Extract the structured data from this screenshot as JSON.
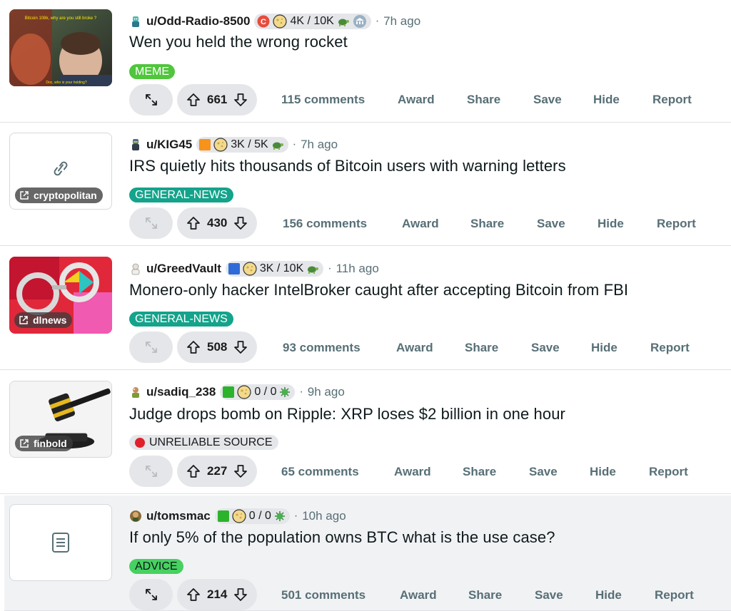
{
  "colors": {
    "meme": "#4fc63b",
    "general_news": "#14a38b",
    "advice": "#46d160",
    "unreliable_dot": "#e0202a"
  },
  "posts": [
    {
      "username": "u/Odd-Radio-8500",
      "flair_text": "4K / 10K",
      "time": "7h ago",
      "title": "Wen you held the wrong rocket",
      "tag": "MEME",
      "votes": "661",
      "comments": "115 comments",
      "thumb_caption": "Bitcoin 108k, why are you still broke ?",
      "thumb_caption2": "Doc, who is your holding?"
    },
    {
      "username": "u/KIG45",
      "flair_text": "3K / 5K",
      "time": "7h ago",
      "title": "IRS quietly hits thousands of Bitcoin users with warning letters",
      "tag": "GENERAL-NEWS",
      "votes": "430",
      "comments": "156 comments",
      "domain": "cryptopolitan"
    },
    {
      "username": "u/GreedVault",
      "flair_text": "3K / 10K",
      "time": "11h ago",
      "title": "Monero-only hacker IntelBroker caught after accepting Bitcoin from FBI",
      "tag": "GENERAL-NEWS",
      "votes": "508",
      "comments": "93 comments",
      "domain": "dlnews"
    },
    {
      "username": "u/sadiq_238",
      "flair_text": "0 / 0",
      "time": "9h ago",
      "title": "Judge drops bomb on Ripple: XRP loses $2 billion in one hour",
      "tag": "UNRELIABLE SOURCE",
      "votes": "227",
      "comments": "65 comments",
      "domain": "finbold"
    },
    {
      "username": "u/tomsmac",
      "flair_text": "0 / 0",
      "time": "10h ago",
      "title": "If only 5% of the population owns BTC what is the use case?",
      "tag": "ADVICE",
      "votes": "214",
      "comments": "501 comments"
    }
  ],
  "labels": {
    "sep": "·",
    "award": "Award",
    "share": "Share",
    "save": "Save",
    "hide": "Hide",
    "report": "Report"
  }
}
